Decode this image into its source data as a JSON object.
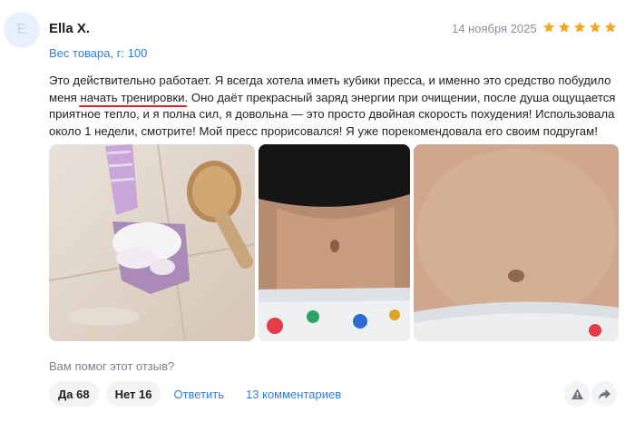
{
  "review": {
    "avatar_letter": "E",
    "author": "Ella X.",
    "date": "14 ноября 2025",
    "rating": 5,
    "rating_max": 5,
    "star_color": "#f5a623",
    "variant": "Вес товара, г: 100",
    "text_part1": "Это действительно работает. Я всегда хотела иметь кубики пресса, и именно это средство побудило меня ",
    "text_highlight": "начать тренировки",
    "text_part2": ". Оно даёт прекрасный заряд энергии при очищении, после душа ощущается приятное тепло, и я полна сил, я довольна — это просто двойная скорость похудения! Использовала около 1 недели, смотрите! Мой пресс прорисовался! Я уже порекомендовала его своим подругам!",
    "highlight_color": "#d6242b",
    "photos": [
      {
        "subject": "soap-bar-with-brush-photo"
      },
      {
        "subject": "belly-photo-1"
      },
      {
        "subject": "belly-photo-2"
      }
    ]
  },
  "footer": {
    "helpful_question": "Вам помог этот отзыв?",
    "yes_label": "Да 68",
    "no_label": "Нет 16",
    "reply_label": "Ответить",
    "comments_label": "13 комментариев",
    "link_color": "#2f7fd8",
    "icons": [
      "report-icon",
      "share-icon"
    ]
  }
}
